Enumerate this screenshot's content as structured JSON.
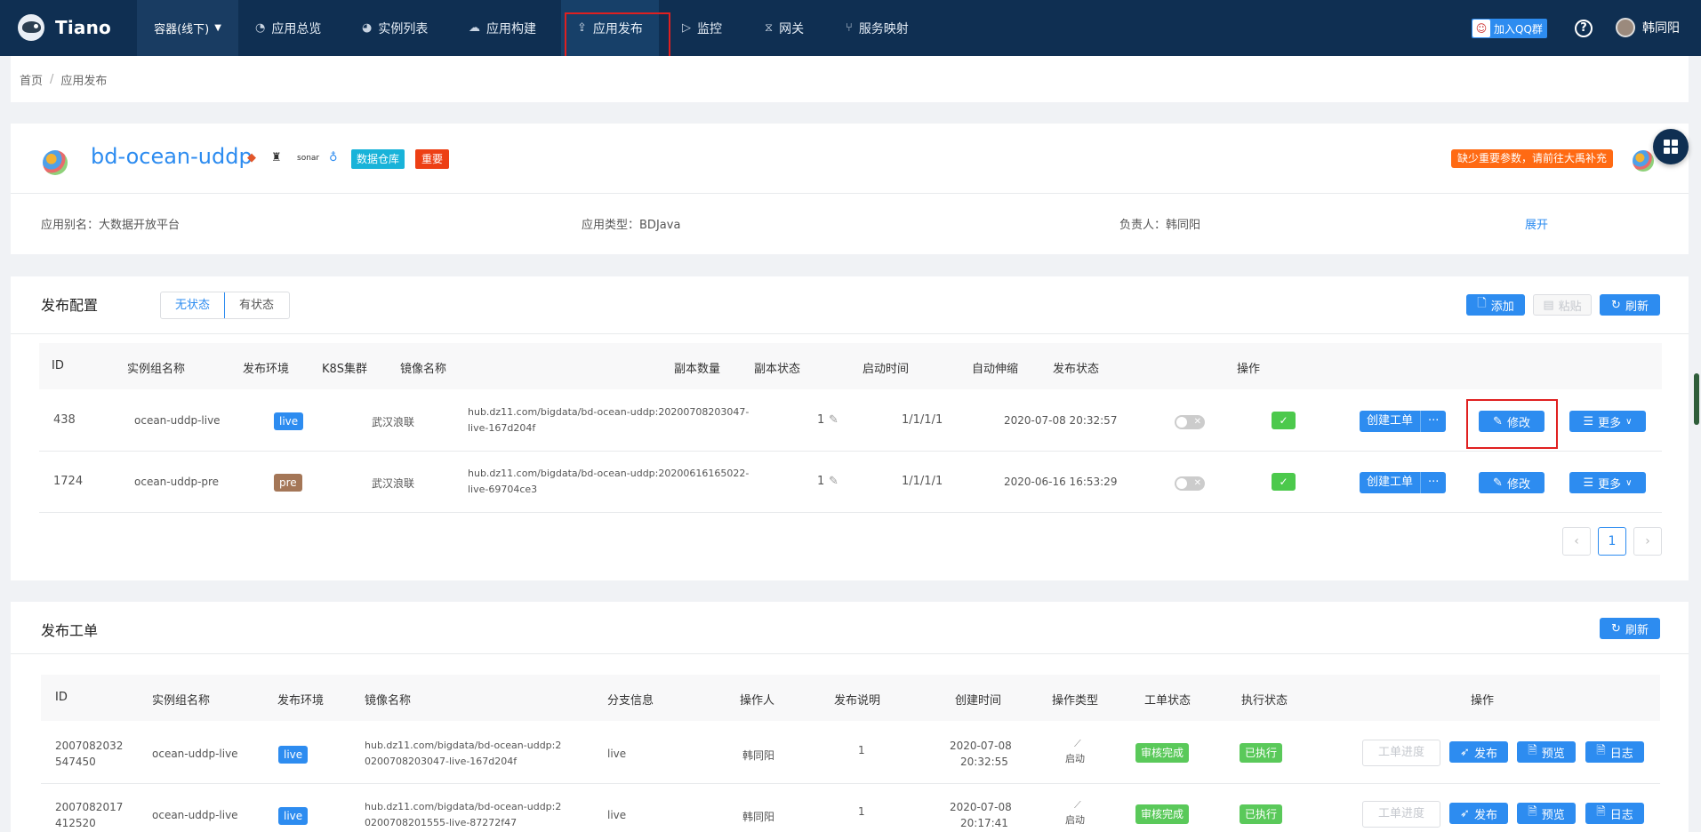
{
  "nav": {
    "brand": "Tiano",
    "context": "容器(线下)",
    "items": [
      {
        "label": "应用总览",
        "icon": "dashboard-icon",
        "glyph": "◔"
      },
      {
        "label": "实例列表",
        "icon": "pie-icon",
        "glyph": "◕"
      },
      {
        "label": "应用构建",
        "icon": "cloud-icon",
        "glyph": "☁"
      },
      {
        "label": "应用发布",
        "icon": "upload-icon",
        "glyph": "⇪"
      },
      {
        "label": "监控",
        "icon": "monitor-icon",
        "glyph": "▷"
      },
      {
        "label": "网关",
        "icon": "hourglass-icon",
        "glyph": "⧖"
      },
      {
        "label": "服务映射",
        "icon": "fork-icon",
        "glyph": "⑂"
      }
    ],
    "qq": "加入QQ群",
    "user": "韩同阳"
  },
  "breadcrumb": {
    "home": "首页",
    "current": "应用发布"
  },
  "app": {
    "name": "bd-ocean-uddp",
    "tag1": "数据仓库",
    "tag2": "重要",
    "warning": "缺少重要参数，请前往大禹补充",
    "sonar": "sonar",
    "alias_label": "应用别名：",
    "alias": "大数据开放平台",
    "type_label": "应用类型：",
    "type": "BDJava",
    "owner_label": "负责人：",
    "owner": "韩同阳",
    "expand": "展开"
  },
  "config": {
    "title": "发布配置",
    "seg_stateless": "无状态",
    "seg_stateful": "有状态",
    "add": "添加",
    "paste": "粘贴",
    "refresh": "刷新",
    "headers": [
      "ID",
      "实例组名称",
      "发布环境",
      "K8S集群",
      "镜像名称",
      "副本数量",
      "副本状态",
      "启动时间",
      "自动伸缩",
      "发布状态",
      "操作"
    ],
    "rows": [
      {
        "id": "438",
        "group": "ocean-uddp-live",
        "env": "live",
        "cluster": "武汉浪联",
        "image1": "hub.dz11.com/bigdata/bd-ocean-uddp:20200708203047-",
        "image2": "live-167d204f",
        "replicas": "1",
        "rstate": "1/1/1/1",
        "start": "2020-07-08 20:32:57"
      },
      {
        "id": "1724",
        "group": "ocean-uddp-pre",
        "env": "pre",
        "cluster": "武汉浪联",
        "image1": "hub.dz11.com/bigdata/bd-ocean-uddp:20200616165022-",
        "image2": "live-69704ce3",
        "replicas": "1",
        "rstate": "1/1/1/1",
        "start": "2020-06-16 16:53:29"
      }
    ],
    "btn_create": "创建工单",
    "btn_more_dots": "···",
    "btn_edit": "修改",
    "btn_more": "更多",
    "page": "1"
  },
  "orders": {
    "title": "发布工单",
    "refresh": "刷新",
    "headers": [
      "ID",
      "实例组名称",
      "发布环境",
      "镜像名称",
      "分支信息",
      "操作人",
      "发布说明",
      "创建时间",
      "操作类型",
      "工单状态",
      "执行状态",
      "操作"
    ],
    "rows": [
      {
        "id1": "2007082032",
        "id2": "547450",
        "group": "ocean-uddp-live",
        "env": "live",
        "image1": "hub.dz11.com/bigdata/bd-ocean-uddp:2",
        "image2": "0200708203047-live-167d204f",
        "branch": "live",
        "operator": "韩同阳",
        "desc": "1",
        "date": "2020-07-08",
        "time": "20:32:55",
        "optype": "启动",
        "status": "审核完成",
        "exec": "已执行"
      },
      {
        "id1": "2007082017",
        "id2": "412520",
        "group": "ocean-uddp-live",
        "env": "live",
        "image1": "hub.dz11.com/bigdata/bd-ocean-uddp:2",
        "image2": "0200708201555-live-87272f47",
        "branch": "live",
        "operator": "韩同阳",
        "desc": "1",
        "date": "2020-07-08",
        "time": "20:17:41",
        "optype": "启动",
        "status": "审核完成",
        "exec": "已执行"
      }
    ],
    "btn_progress": "工单进度",
    "btn_publish": "发布",
    "btn_preview": "预览",
    "btn_log": "日志"
  }
}
